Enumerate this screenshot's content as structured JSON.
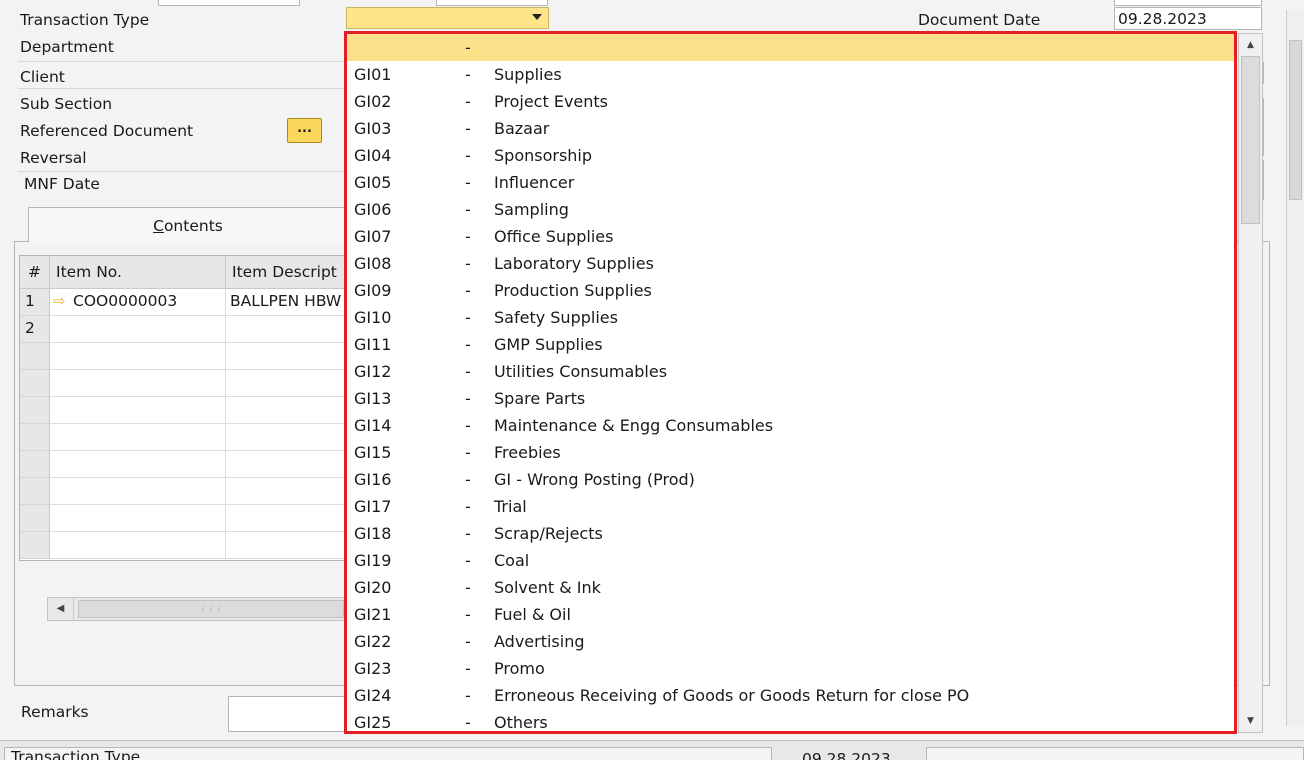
{
  "header": {
    "labels": {
      "transaction_type": "Transaction Type",
      "department": "Department",
      "client": "Client",
      "sub_section": "Sub Section",
      "referenced_document": "Referenced Document",
      "reversal": "Reversal",
      "mnf_date": "MNF Date"
    },
    "ref_button_label": "...",
    "right": {
      "document_date_label": "Document Date",
      "document_date_value": "09.28.2023"
    }
  },
  "tabs": {
    "contents": {
      "prefix": "",
      "mnemonic": "C",
      "rest": "ontents"
    }
  },
  "grid": {
    "columns": [
      "#",
      "Item No.",
      "Item Descript"
    ],
    "rows": [
      {
        "num": "1",
        "item_no": "COO0000003",
        "description": "BALLPEN HBW"
      },
      {
        "num": "2",
        "item_no": "",
        "description": ""
      },
      {
        "num": "",
        "item_no": "",
        "description": ""
      },
      {
        "num": "",
        "item_no": "",
        "description": ""
      },
      {
        "num": "",
        "item_no": "",
        "description": ""
      },
      {
        "num": "",
        "item_no": "",
        "description": ""
      },
      {
        "num": "",
        "item_no": "",
        "description": ""
      },
      {
        "num": "",
        "item_no": "",
        "description": ""
      },
      {
        "num": "",
        "item_no": "",
        "description": ""
      },
      {
        "num": "",
        "item_no": "",
        "description": ""
      }
    ]
  },
  "remarks_label": "Remarks",
  "statusbar": {
    "field_name": "Transaction Type",
    "date": "09.28.2023"
  },
  "dropdown": {
    "options": [
      {
        "code": "",
        "dash": "-",
        "desc": "",
        "selected": true
      },
      {
        "code": "GI01",
        "dash": "-",
        "desc": "Supplies"
      },
      {
        "code": "GI02",
        "dash": "-",
        "desc": "Project Events"
      },
      {
        "code": "GI03",
        "dash": "-",
        "desc": "Bazaar"
      },
      {
        "code": "GI04",
        "dash": "-",
        "desc": "Sponsorship"
      },
      {
        "code": "GI05",
        "dash": "-",
        "desc": "Influencer"
      },
      {
        "code": "GI06",
        "dash": "-",
        "desc": "Sampling"
      },
      {
        "code": "GI07",
        "dash": "-",
        "desc": "Office Supplies"
      },
      {
        "code": "GI08",
        "dash": "-",
        "desc": "Laboratory Supplies"
      },
      {
        "code": "GI09",
        "dash": "-",
        "desc": "Production Supplies"
      },
      {
        "code": "GI10",
        "dash": "-",
        "desc": "Safety Supplies"
      },
      {
        "code": "GI11",
        "dash": "-",
        "desc": "GMP Supplies"
      },
      {
        "code": "GI12",
        "dash": "-",
        "desc": "Utilities Consumables"
      },
      {
        "code": "GI13",
        "dash": "-",
        "desc": "Spare Parts"
      },
      {
        "code": "GI14",
        "dash": "-",
        "desc": "Maintenance & Engg Consumables"
      },
      {
        "code": "GI15",
        "dash": "-",
        "desc": "Freebies"
      },
      {
        "code": "GI16",
        "dash": "-",
        "desc": "GI - Wrong Posting (Prod)"
      },
      {
        "code": "GI17",
        "dash": "-",
        "desc": "Trial"
      },
      {
        "code": "GI18",
        "dash": "-",
        "desc": "Scrap/Rejects"
      },
      {
        "code": "GI19",
        "dash": "-",
        "desc": "Coal"
      },
      {
        "code": "GI20",
        "dash": "-",
        "desc": "Solvent & Ink"
      },
      {
        "code": "GI21",
        "dash": "-",
        "desc": "Fuel & Oil"
      },
      {
        "code": "GI22",
        "dash": "-",
        "desc": "Advertising"
      },
      {
        "code": "GI23",
        "dash": "-",
        "desc": "Promo"
      },
      {
        "code": "GI24",
        "dash": "-",
        "desc": "Erroneous Receiving of Goods or Goods Return for close PO"
      },
      {
        "code": "GI25",
        "dash": "-",
        "desc": "Others"
      }
    ]
  },
  "colors": {
    "highlight_border": "#e31e24",
    "selected_row": "#fde18a",
    "select_field": "#fde58a",
    "button_yellow": "#fbd75b"
  },
  "icons": {
    "row_indicator": "arrow-right-icon",
    "dropdown_arrow": "chevron-down-icon"
  }
}
